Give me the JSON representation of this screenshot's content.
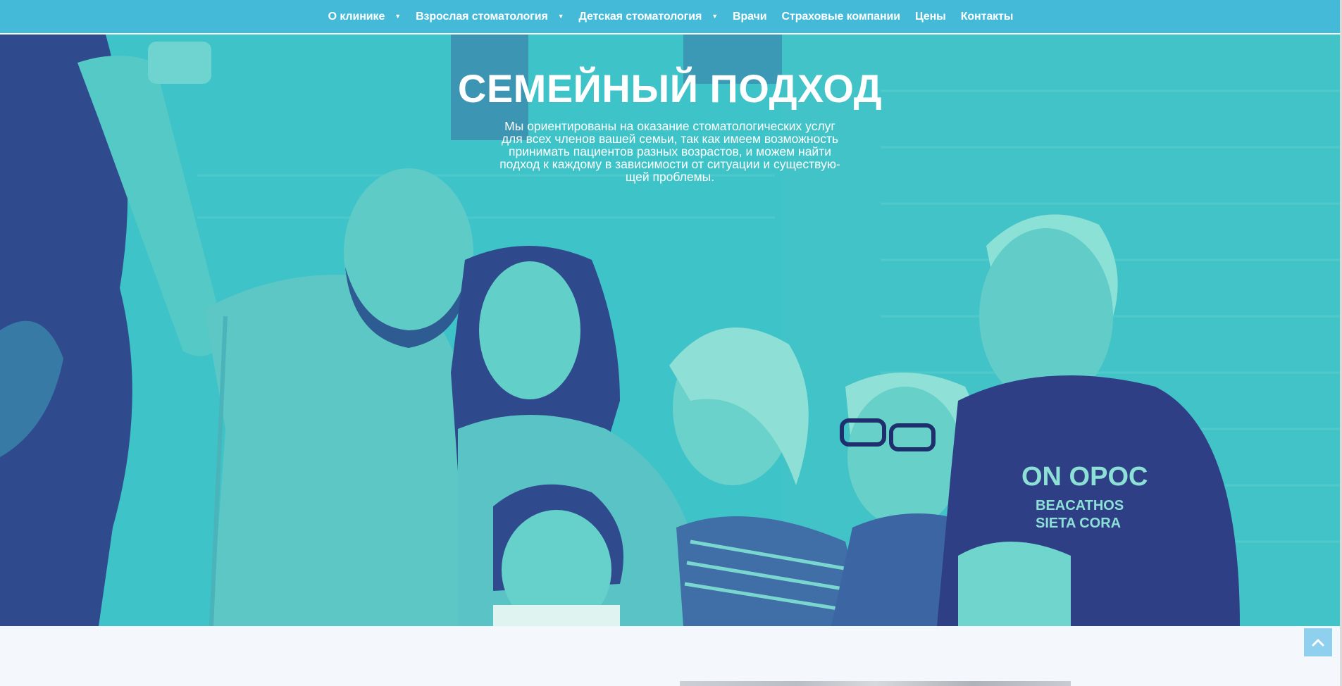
{
  "nav": {
    "items": [
      {
        "label": "О клинике",
        "dropdown": true
      },
      {
        "label": "Взрослая стоматология",
        "dropdown": true
      },
      {
        "label": "Детская стоматология",
        "dropdown": true
      },
      {
        "label": "Врачи",
        "dropdown": false
      },
      {
        "label": "Страховые компании",
        "dropdown": false
      },
      {
        "label": "Цены",
        "dropdown": false
      },
      {
        "label": "Контакты",
        "dropdown": false
      }
    ],
    "caret": "▼"
  },
  "hero": {
    "title": "СЕМЕЙНЫЙ ПОДХОД",
    "text_lines": [
      "Мы ориентированы на оказание стоматологических услуг",
      "для всех членов вашей семьи, так как имеем возможность",
      "принимать пациентов разных возрастов, и можем найти",
      "подход к каждому в зависимости от ситуации и существую-",
      "щей  проблемы."
    ],
    "image_description_icon": "family-selfie-photo"
  },
  "scroll_top": {
    "icon": "chevron-up-icon"
  },
  "colors": {
    "nav_bg": "#45bad8",
    "hero_tint": "#3dc0c7",
    "hero_shadow": "#2e4a8f",
    "scroll_top_bg": "#8fd0ef",
    "page_bg": "#f4f8fd"
  }
}
